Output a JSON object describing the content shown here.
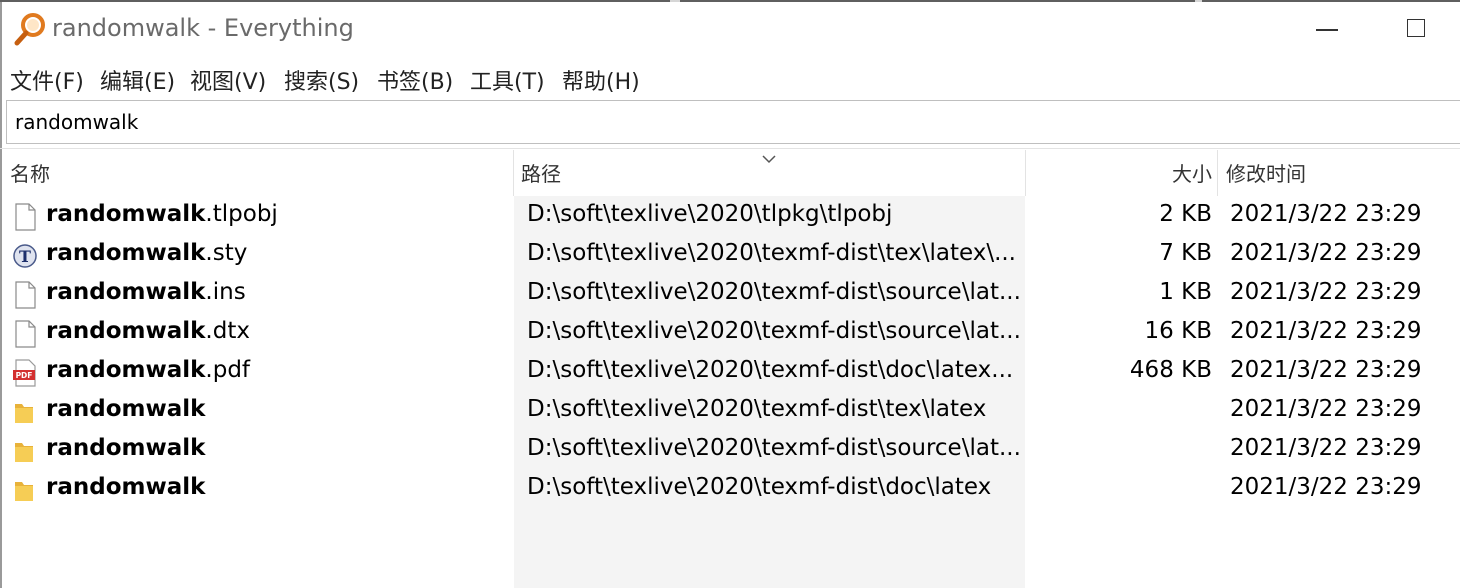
{
  "window": {
    "title": "randomwalk - Everything",
    "app_icon": "magnifier-icon",
    "controls": [
      "minimize-icon",
      "maximize-icon"
    ]
  },
  "menu": [
    "文件(F)",
    "编辑(E)",
    "视图(V)",
    "搜索(S)",
    "书签(B)",
    "工具(T)",
    "帮助(H)"
  ],
  "search": {
    "value": "randomwalk"
  },
  "columns": {
    "name": "名称",
    "path": "路径",
    "size": "大小",
    "modified": "修改时间"
  },
  "sorted_column": "path",
  "query_highlight": "randomwalk",
  "rows": [
    {
      "name_match": "randomwalk",
      "name_rest": ".tlpobj",
      "path": "D:\\soft\\texlive\\2020\\tlpkg\\tlpobj",
      "size": "2 KB",
      "modified": "2021/3/22 23:29",
      "icon": "file-icon"
    },
    {
      "name_match": "randomwalk",
      "name_rest": ".sty",
      "path": "D:\\soft\\texlive\\2020\\texmf-dist\\tex\\latex\\...",
      "size": "7 KB",
      "modified": "2021/3/22 23:29",
      "icon": "tex-file-icon"
    },
    {
      "name_match": "randomwalk",
      "name_rest": ".ins",
      "path": "D:\\soft\\texlive\\2020\\texmf-dist\\source\\lat...",
      "size": "1 KB",
      "modified": "2021/3/22 23:29",
      "icon": "file-icon"
    },
    {
      "name_match": "randomwalk",
      "name_rest": ".dtx",
      "path": "D:\\soft\\texlive\\2020\\texmf-dist\\source\\lat...",
      "size": "16 KB",
      "modified": "2021/3/22 23:29",
      "icon": "file-icon"
    },
    {
      "name_match": "randomwalk",
      "name_rest": ".pdf",
      "path": "D:\\soft\\texlive\\2020\\texmf-dist\\doc\\latex...",
      "size": "468 KB",
      "modified": "2021/3/22 23:29",
      "icon": "pdf-icon"
    },
    {
      "name_match": "randomwalk",
      "name_rest": "",
      "path": "D:\\soft\\texlive\\2020\\texmf-dist\\tex\\latex",
      "size": "",
      "modified": "2021/3/22 23:29",
      "icon": "folder-icon"
    },
    {
      "name_match": "randomwalk",
      "name_rest": "",
      "path": "D:\\soft\\texlive\\2020\\texmf-dist\\source\\lat...",
      "size": "",
      "modified": "2021/3/22 23:29",
      "icon": "folder-icon"
    },
    {
      "name_match": "randomwalk",
      "name_rest": "",
      "path": "D:\\soft\\texlive\\2020\\texmf-dist\\doc\\latex",
      "size": "",
      "modified": "2021/3/22 23:29",
      "icon": "folder-icon"
    }
  ],
  "colors": {
    "accent_orange": "#e07a1f",
    "folder_yellow": "#f3c64b",
    "pdf_red": "#d32f2f",
    "path_column_bg": "#f4f4f4"
  }
}
